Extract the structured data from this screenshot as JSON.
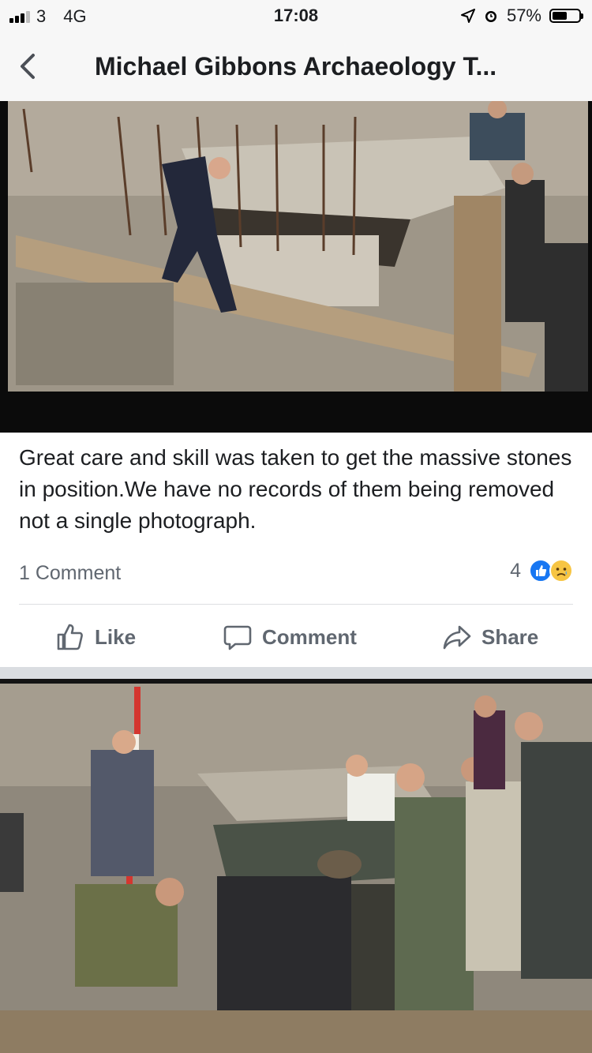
{
  "status_bar": {
    "carrier": "3",
    "network": "4G",
    "time": "17:08",
    "battery": "57%",
    "battery_level": 0.57
  },
  "nav": {
    "title": "Michael Gibbons Archaeology T...",
    "back_icon": "chevron-left-icon"
  },
  "post": {
    "text": "Great care and skill  was taken to get the massive stones in position.We have no records of them being removed not a single photograph.",
    "comment_count": "1 Comment",
    "reaction_count": "4",
    "reactions": [
      "like-icon",
      "sad-icon"
    ]
  },
  "actions": {
    "like": "Like",
    "comment": "Comment",
    "share": "Share"
  },
  "colors": {
    "accent": "#1877f2",
    "muted": "#606770",
    "text": "#1c1e21"
  }
}
